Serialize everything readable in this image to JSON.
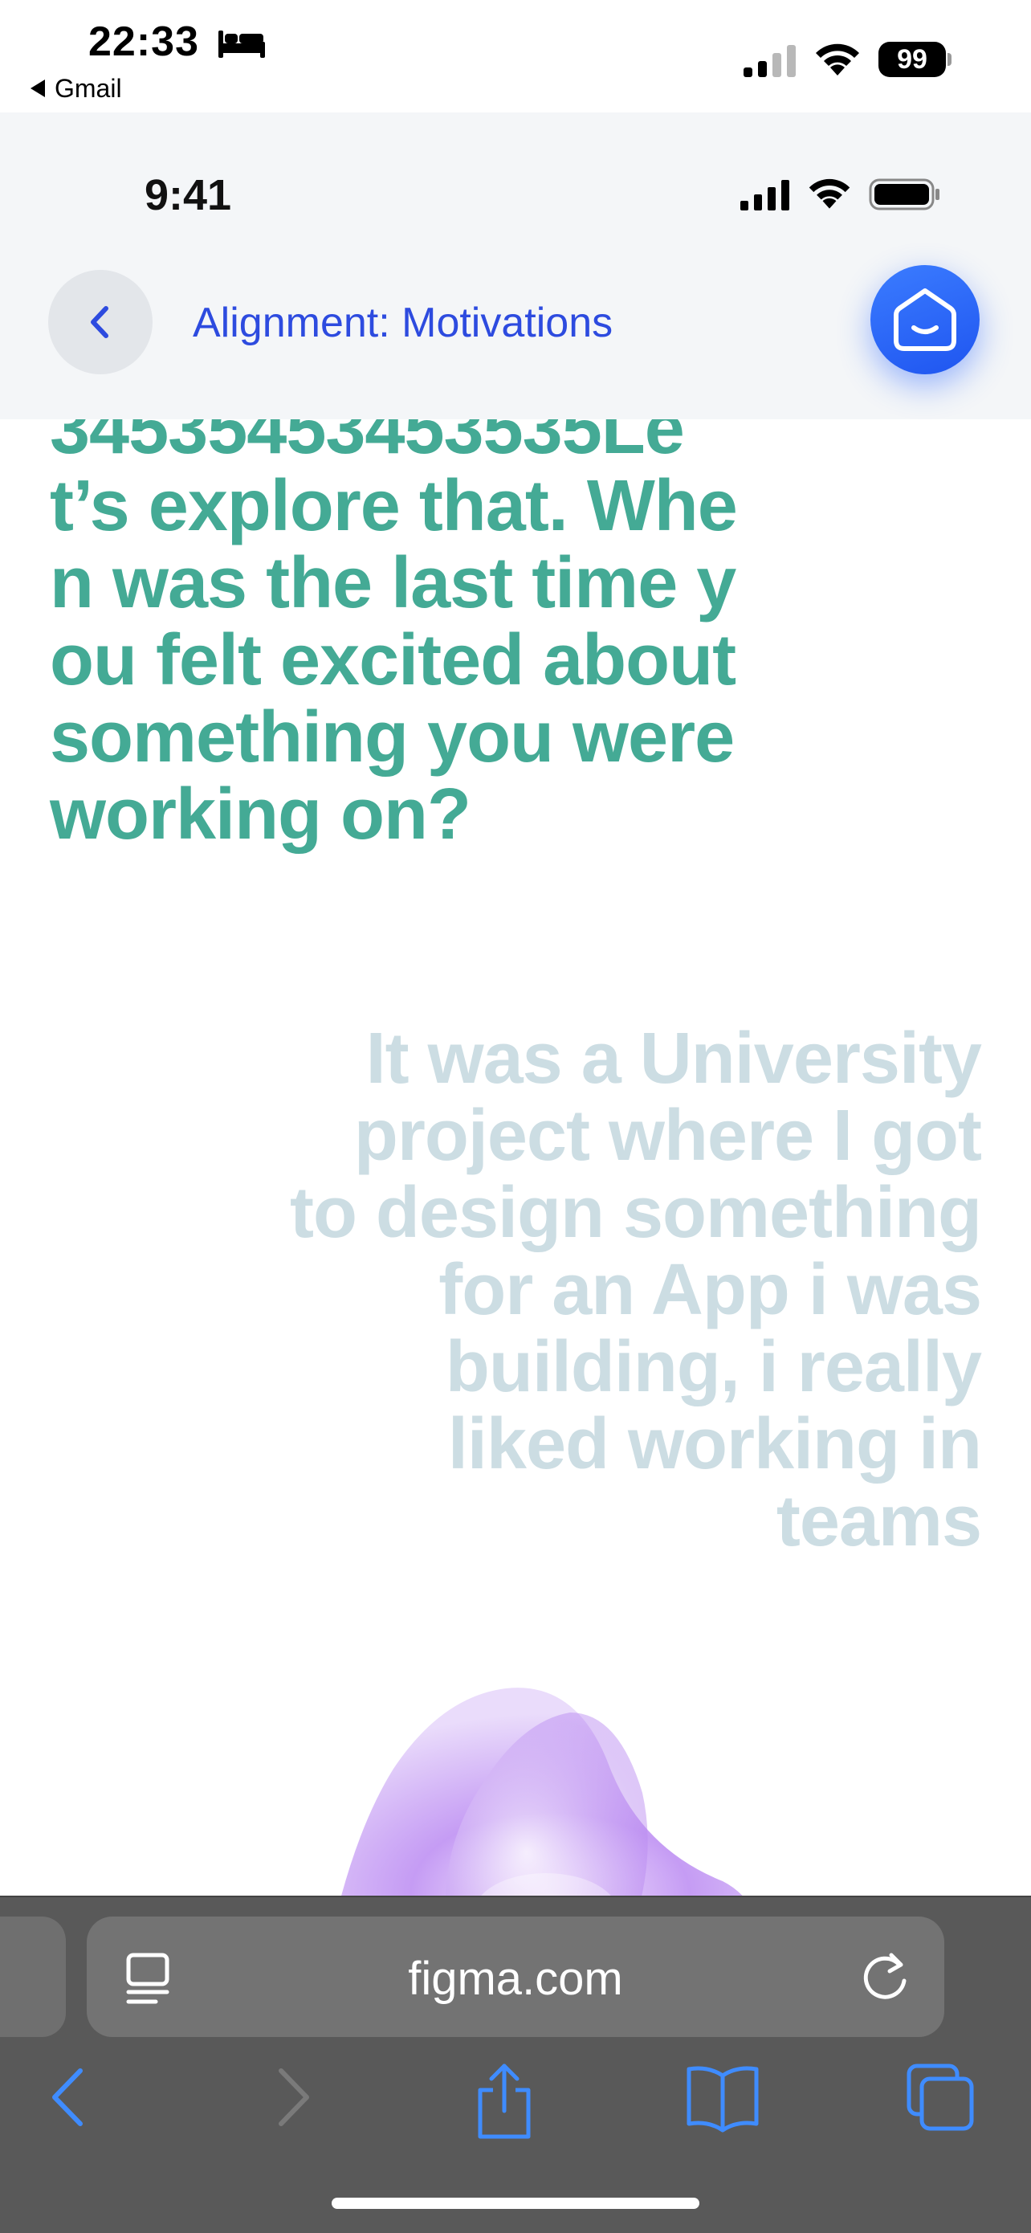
{
  "device_status": {
    "time": "22:33",
    "back_app": "Gmail",
    "battery": "99"
  },
  "proto_status": {
    "time": "9:41"
  },
  "header": {
    "title": "Alignment: Motivations"
  },
  "conversation": {
    "question": "34535453453535Let’s explore that. When was the last time you felt excited about something you were working on?",
    "answer": "It was a University project where I got to design something for an App i was building, i really liked working in teams"
  },
  "browser": {
    "url": "figma.com"
  },
  "colors": {
    "accent_blue": "#2d4bdf",
    "question_green": "#44aa95",
    "answer_grey": "#ccdde3",
    "safari_icon_blue": "#3f8cff"
  }
}
